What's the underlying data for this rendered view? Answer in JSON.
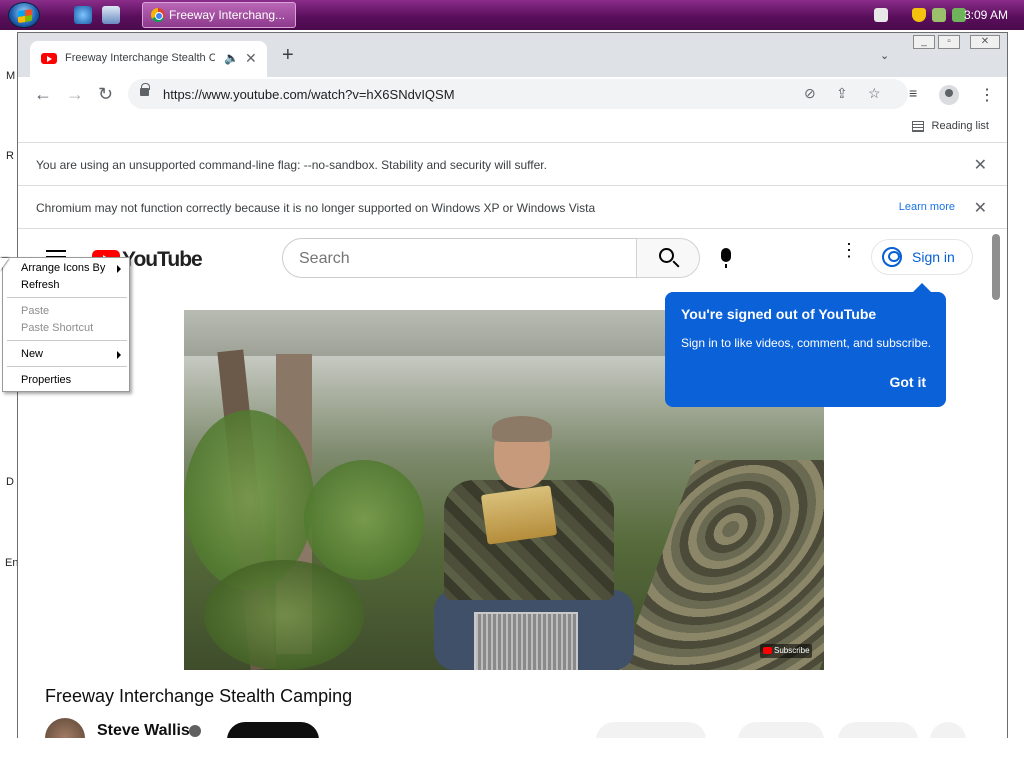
{
  "taskbar": {
    "start_icon": "windows-orb-icon",
    "quicklaunch": [
      "internet-explorer-icon",
      "chrome-icon"
    ],
    "task_title": "Freeway Interchang...",
    "clock": "3:09 AM",
    "tray_icons": [
      "keyboard-icon",
      "shield-icon",
      "network-icon",
      "usb-icon"
    ]
  },
  "desktop": {
    "letters": [
      "M",
      "R",
      "D",
      "En"
    ]
  },
  "browser": {
    "tab": {
      "title": "Freeway Interchange Stealth Ca"
    },
    "url": "https://www.youtube.com/watch?v=hX6SNdvIQSM",
    "reading_list": "Reading list",
    "infobars": [
      {
        "message": "You are using an unsupported command-line flag: --no-sandbox. Stability and security will suffer."
      },
      {
        "message": "Chromium may not function correctly because it is no longer supported on Windows XP or Windows Vista",
        "link": "Learn more"
      }
    ]
  },
  "youtube": {
    "logo": "YouTube",
    "search_placeholder": "Search",
    "sign_in": "Sign in",
    "tooltip": {
      "title": "You're signed out of YouTube",
      "body": "Sign in to like videos, comment, and subscribe.",
      "action": "Got it"
    },
    "video": {
      "watermark": "Subscribe"
    },
    "video_title": "Freeway Interchange Stealth Camping",
    "channel": "Steve Wallis"
  },
  "context_menu": {
    "items": [
      {
        "label": "Arrange Icons By",
        "submenu": true
      },
      {
        "label": "Refresh"
      },
      {
        "label": "Paste",
        "disabled": true
      },
      {
        "label": "Paste Shortcut",
        "disabled": true
      },
      {
        "label": "New",
        "submenu": true
      },
      {
        "label": "Properties"
      }
    ]
  },
  "colors": {
    "youtube_red": "#ff0000",
    "tooltip_blue": "#0b61d8",
    "taskbar": "#5a0f5c",
    "link_blue": "#1a73e8"
  }
}
